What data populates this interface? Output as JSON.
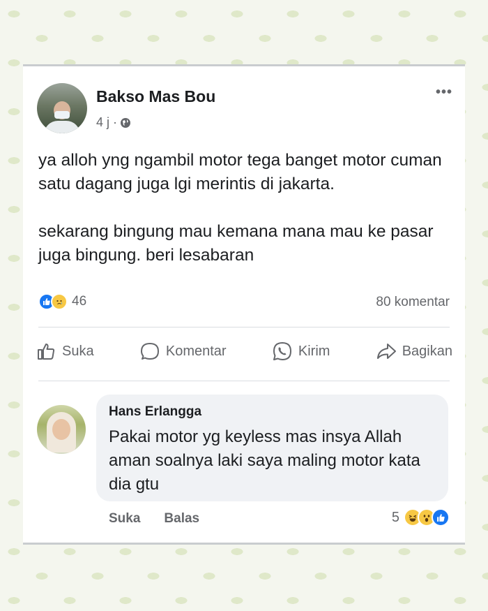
{
  "post": {
    "author": "Bakso Mas Bou",
    "time": "4 j ·",
    "text_p1": "ya alloh yng ngambil motor tega banget motor cuman satu dagang juga lgi merintis di jakarta.",
    "text_p2": "sekarang bingung mau kemana mana mau ke pasar juga bingung.  beri lesabaran",
    "reaction_count": "46",
    "comment_count": "80 komentar",
    "reaction_icons": [
      "like-icon",
      "sad-icon"
    ]
  },
  "actions": {
    "like": "Suka",
    "comment": "Komentar",
    "send": "Kirim",
    "share": "Bagikan"
  },
  "comment": {
    "author": "Hans Erlangga",
    "text": "Pakai motor yg keyless mas insya Allah aman soalnya laki saya maling motor kata dia gtu",
    "like_label": "Suka",
    "reply_label": "Balas",
    "reaction_count": "5",
    "reaction_icons": [
      "haha-icon",
      "wow-icon",
      "like-icon"
    ]
  },
  "colors": {
    "accent": "#1877f2",
    "text": "#1c1e21",
    "secondary_text": "#65676b",
    "comment_bubble": "#f0f2f5"
  }
}
